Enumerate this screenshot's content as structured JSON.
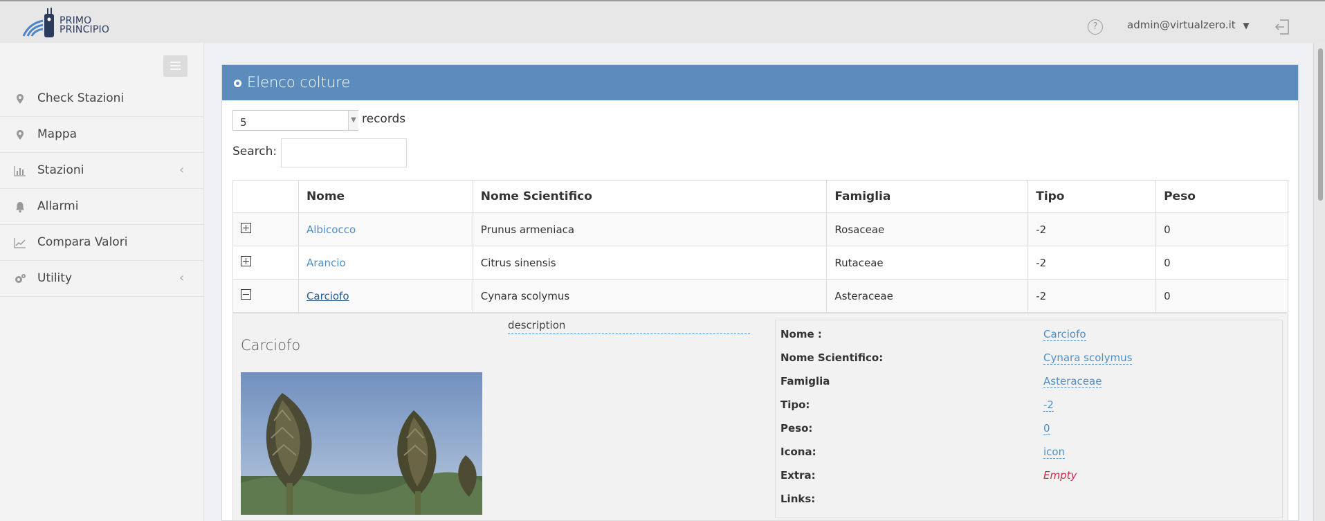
{
  "brand": {
    "line1": "PRIMO",
    "line2": "PRINCIPIO"
  },
  "header": {
    "help_icon": "?",
    "user": "admin@virtualzero.it",
    "user_caret": "⌄"
  },
  "sidebar": {
    "items": [
      {
        "label": "Check Stazioni",
        "icon": "map-pin-icon",
        "submenu": false
      },
      {
        "label": "Mappa",
        "icon": "map-pin-icon",
        "submenu": false
      },
      {
        "label": "Stazioni",
        "icon": "bar-chart-icon",
        "submenu": true
      },
      {
        "label": "Allarmi",
        "icon": "bell-icon",
        "submenu": false
      },
      {
        "label": "Compara Valori",
        "icon": "line-chart-icon",
        "submenu": false
      },
      {
        "label": "Utility",
        "icon": "gears-icon",
        "submenu": true
      }
    ],
    "chevron": "‹"
  },
  "panel": {
    "title": "Elenco colture"
  },
  "controls": {
    "records_value": "5",
    "records_label": "records",
    "search_label": "Search:"
  },
  "table": {
    "columns": [
      "Nome",
      "Nome Scientifico",
      "Famiglia",
      "Tipo",
      "Peso"
    ],
    "rows": [
      {
        "nome": "Albicocco",
        "scientifico": "Prunus armeniaca",
        "famiglia": "Rosaceae",
        "tipo": "-2",
        "peso": "0",
        "expanded": false
      },
      {
        "nome": "Arancio",
        "scientifico": "Citrus sinensis",
        "famiglia": "Rutaceae",
        "tipo": "-2",
        "peso": "0",
        "expanded": false
      },
      {
        "nome": "Carciofo",
        "scientifico": "Cynara scolymus",
        "famiglia": "Asteraceae",
        "tipo": "-2",
        "peso": "0",
        "expanded": true
      }
    ]
  },
  "detail": {
    "name": "Carciofo",
    "description": "description",
    "props": [
      {
        "label": "Nome :",
        "value": "Carciofo"
      },
      {
        "label": "Nome Scientifico:",
        "value": "Cynara scolymus"
      },
      {
        "label": "Famiglia",
        "value": "Asteraceae"
      },
      {
        "label": "Tipo:",
        "value": "-2"
      },
      {
        "label": "Peso:",
        "value": "0"
      },
      {
        "label": "Icona:",
        "value": "icon"
      },
      {
        "label": "Extra:",
        "value": "Empty"
      },
      {
        "label": "Links:",
        "value": ""
      }
    ]
  },
  "colors": {
    "panel_header": "#5b8cbb",
    "link": "#4e8ec7",
    "empty_value": "#d0284c"
  }
}
